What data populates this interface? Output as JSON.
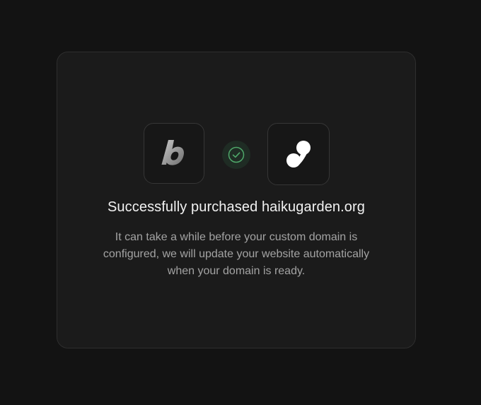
{
  "dialog": {
    "title": "Successfully purchased haikugarden.org",
    "description": "It can take a while before your custom domain is configured, we will update your website automatically when your domain is ready.",
    "left_logo_icon": "b-brand-logo-icon",
    "status_icon": "check-circle-icon",
    "right_logo_icon": "infinity-link-logo-icon"
  },
  "colors": {
    "background": "#131313",
    "card": "#1b1b1b",
    "success": "#4fa86a"
  }
}
